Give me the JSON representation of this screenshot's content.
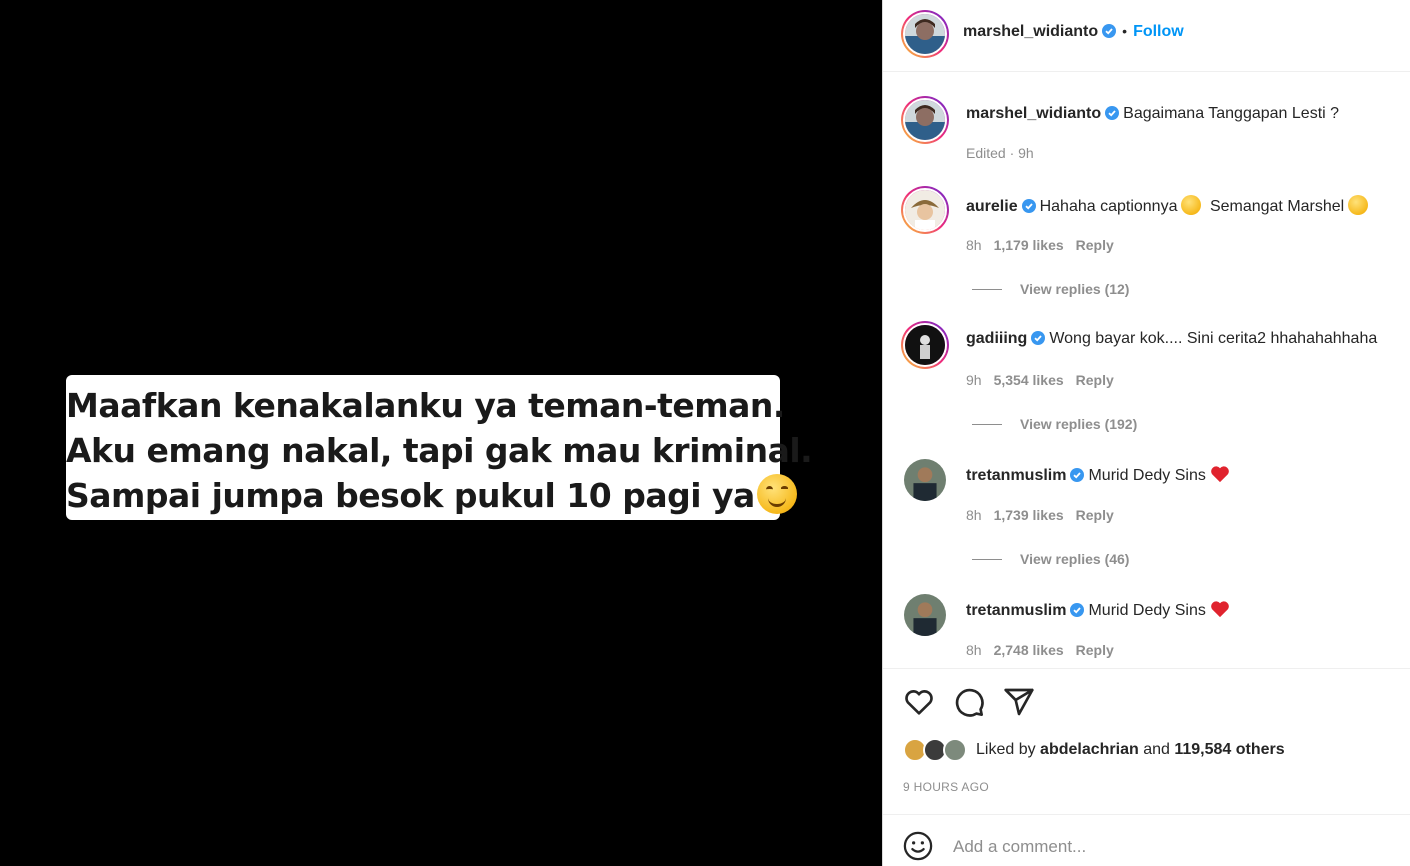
{
  "post": {
    "caption_lines": [
      "Maafkan kenakalanku ya teman-teman.",
      "Aku emang nakal, tapi gak mau kriminal.",
      "Sampai jumpa besok pukul 10 pagi ya"
    ],
    "caption_emoji": "smiling-face-emoji"
  },
  "header": {
    "username": "marshel_widianto",
    "separator": "•",
    "follow_label": "Follow"
  },
  "owner_comment": {
    "username": "marshel_widianto",
    "text": "Bagaimana Tanggapan Lesti ?",
    "edited": "Edited · 9h"
  },
  "comments": [
    {
      "username": "aurelie",
      "text": "Hahaha captionnya",
      "text2": "Semangat Marshel",
      "time": "8h",
      "likes": "1,179 likes",
      "reply": "Reply",
      "view_replies": "View replies (12)"
    },
    {
      "username": "gadiiing",
      "text": "Wong bayar kok.... Sini cerita2 hhahahahhaha",
      "time": "9h",
      "likes": "5,354 likes",
      "reply": "Reply",
      "view_replies": "View replies (192)"
    },
    {
      "username": "tretanmuslim",
      "text": "Murid Dedy Sins",
      "time": "8h",
      "likes": "1,739 likes",
      "reply": "Reply",
      "view_replies": "View replies (46)"
    },
    {
      "username": "tretanmuslim",
      "text": "Murid Dedy Sins",
      "time": "8h",
      "likes": "2,748 likes",
      "reply": "Reply"
    }
  ],
  "likes": {
    "prefix": "Liked by",
    "user": "abdelachrian",
    "middle": "and",
    "count": "119,584 others"
  },
  "timestamp": "9 HOURS AGO",
  "comment_box": {
    "placeholder": "Add a comment..."
  },
  "colors": {
    "accent": "#0095f6",
    "verified": "#3897f0",
    "heart": "#ed4956"
  }
}
